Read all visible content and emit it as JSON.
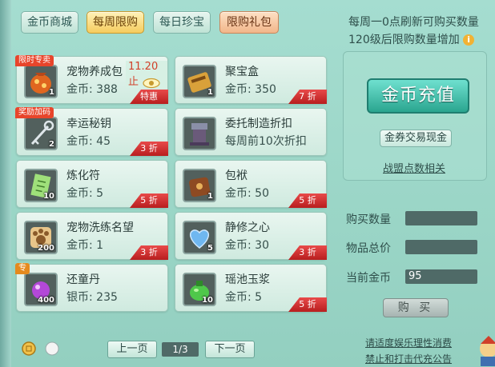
{
  "tabs": [
    {
      "label": "金币商城",
      "state": "normal"
    },
    {
      "label": "每周限购",
      "state": "active"
    },
    {
      "label": "每日珍宝",
      "state": "normal"
    },
    {
      "label": "限购礼包",
      "state": "gift"
    }
  ],
  "notice": {
    "line1": "每周一0点刷新可购买数量",
    "line2": "120级后限购数量增加"
  },
  "items": [
    {
      "name": "宠物养成包",
      "price": "金币: 388",
      "qty": "1",
      "tag": "限时专卖",
      "timer": "11.20止",
      "discount": "特惠",
      "icon": "pet-growth-pack-icon"
    },
    {
      "name": "聚宝盒",
      "price": "金币: 350",
      "qty": "1",
      "tag": "",
      "timer": "",
      "discount": "7 折",
      "icon": "treasure-box-icon"
    },
    {
      "name": "幸运秘钥",
      "price": "金币: 45",
      "qty": "2",
      "tag": "奖励加码",
      "timer": "",
      "discount": "3 折",
      "icon": "lucky-key-icon"
    },
    {
      "name": "委托制造折扣",
      "price": "每周前10次折扣",
      "qty": "",
      "tag": "",
      "timer": "",
      "discount": "",
      "icon": "commission-discount-icon"
    },
    {
      "name": "炼化符",
      "price": "金币: 5",
      "qty": "10",
      "tag": "",
      "timer": "",
      "discount": "5 折",
      "icon": "refine-talisman-icon"
    },
    {
      "name": "包袱",
      "price": "金币: 50",
      "qty": "1",
      "tag": "",
      "timer": "",
      "discount": "5 折",
      "icon": "bag-icon"
    },
    {
      "name": "宠物洗练名望",
      "price": "金币: 1",
      "qty": "200",
      "tag": "",
      "timer": "",
      "discount": "3 折",
      "icon": "pet-reputation-icon"
    },
    {
      "name": "静修之心",
      "price": "金币: 30",
      "qty": "5",
      "tag": "",
      "timer": "",
      "discount": "3 折",
      "icon": "meditation-heart-icon"
    },
    {
      "name": "还童丹",
      "price": "银币: 235",
      "qty": "400",
      "tag": "专",
      "timer": "",
      "discount": "",
      "icon": "rejuvenation-pill-icon"
    },
    {
      "name": "瑶池玉浆",
      "price": "金币: 5",
      "qty": "10",
      "tag": "",
      "timer": "",
      "discount": "5 折",
      "icon": "jade-nectar-icon"
    }
  ],
  "side": {
    "recharge_label": "金币充值",
    "voucher_label": "金券交易现金",
    "alliance_label": "战盟点数相关",
    "buy_qty_label": "购买数量",
    "total_label": "物品总价",
    "gold_label": "当前金币",
    "buy_qty_value": "",
    "total_value": "",
    "gold_value": "95",
    "buy_label": "购 买"
  },
  "pager": {
    "prev": "上一页",
    "page": "1/3",
    "next": "下一页"
  },
  "footer": {
    "line1": "请适度娱乐理性消费",
    "line2": "禁止和打击代充公告"
  },
  "colors": {
    "active_tab": "#f5cc5e",
    "discount": "#d23030",
    "panel_bg": "#a5ddd0",
    "recharge": "#2aa58f"
  }
}
